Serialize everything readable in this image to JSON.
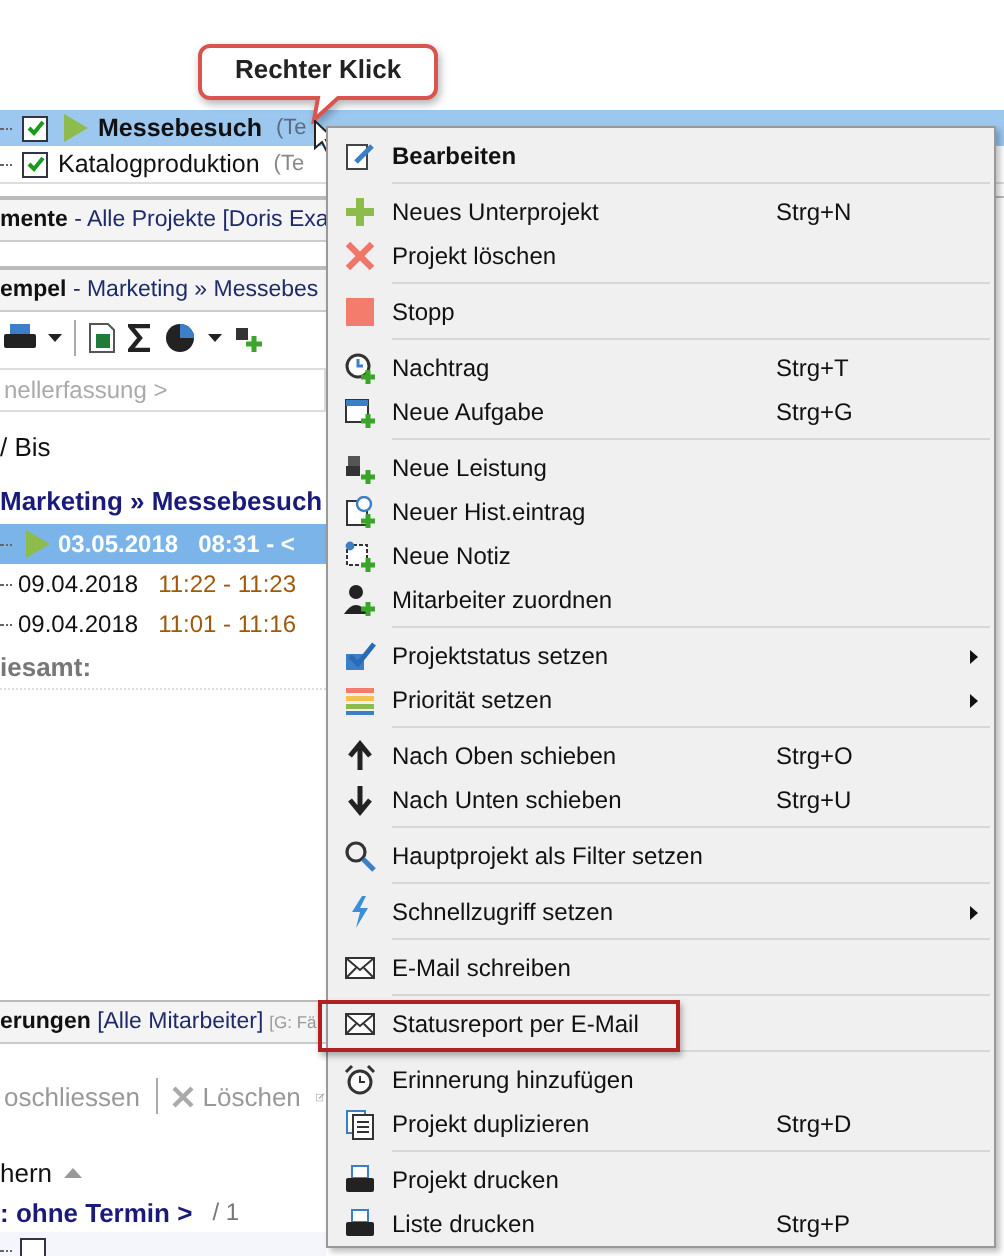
{
  "callout": {
    "text": "Rechter Klick"
  },
  "project_tree": {
    "rows": [
      {
        "name": "Messebesuch",
        "tag": "(Te",
        "checked": true,
        "running": true,
        "selected": true
      },
      {
        "name": "Katalogproduktion",
        "tag": "(Te",
        "checked": true,
        "running": false,
        "selected": false
      }
    ]
  },
  "documents_panel": {
    "title": "**mente** - Alle Projekte [Doris Exa"
  },
  "time_panel": {
    "title": "**empel** - Marketing » Messebes",
    "breadcrumb": "nellerfassung >",
    "column_header": "/ Bis",
    "group": "Marketing » Messebesuch",
    "rows": [
      {
        "date": "03.05.2018",
        "time": "08:31 - <",
        "selected": true,
        "running": true
      },
      {
        "date": "09.04.2018",
        "time": "11:22 - 11:23",
        "selected": false,
        "running": false
      },
      {
        "date": "09.04.2018",
        "time": "11:01 - 11:16",
        "selected": false,
        "running": false
      }
    ],
    "total_label": "iesamt:"
  },
  "reminders_panel": {
    "title": "**erungen** [Alle Mitarbeiter]",
    "filter": "[G: Fä",
    "toolbar": [
      "oschliessen",
      "Löschen"
    ],
    "sort_column": "hern",
    "group": ": ohne Termin >",
    "count": "/ 1",
    "rows": [
      {
        "checked": false
      }
    ]
  },
  "context_menu": {
    "groups": [
      [
        {
          "label": "Bearbeiten",
          "default": true,
          "submenu": false,
          "highlighted": false
        }
      ],
      [
        {
          "label": "Neues Unterprojekt",
          "shortcut": "Strg+N",
          "default": false,
          "submenu": false,
          "highlighted": false
        },
        {
          "label": "Projekt löschen",
          "default": false,
          "submenu": false,
          "highlighted": false
        }
      ],
      [
        {
          "label": "Stopp",
          "default": false,
          "submenu": false,
          "highlighted": false
        }
      ],
      [
        {
          "label": "Nachtrag",
          "shortcut": "Strg+T",
          "default": false,
          "submenu": false,
          "highlighted": false
        },
        {
          "label": "Neue Aufgabe",
          "shortcut": "Strg+G",
          "default": false,
          "submenu": false,
          "highlighted": false
        }
      ],
      [
        {
          "label": "Neue Leistung",
          "default": false,
          "submenu": false,
          "highlighted": false
        },
        {
          "label": "Neuer Hist.eintrag",
          "default": false,
          "submenu": false,
          "highlighted": false
        },
        {
          "label": "Neue Notiz",
          "default": false,
          "submenu": false,
          "highlighted": false
        },
        {
          "label": "Mitarbeiter zuordnen",
          "default": false,
          "submenu": false,
          "highlighted": false
        }
      ],
      [
        {
          "label": "Projektstatus setzen",
          "default": false,
          "submenu": true,
          "highlighted": false
        },
        {
          "label": "Priorität setzen",
          "default": false,
          "submenu": true,
          "highlighted": false
        }
      ],
      [
        {
          "label": "Nach Oben schieben",
          "shortcut": "Strg+O",
          "default": false,
          "submenu": false,
          "highlighted": false
        },
        {
          "label": "Nach Unten schieben",
          "shortcut": "Strg+U",
          "default": false,
          "submenu": false,
          "highlighted": false
        }
      ],
      [
        {
          "label": "Hauptprojekt als Filter setzen",
          "default": false,
          "submenu": false,
          "highlighted": false
        }
      ],
      [
        {
          "label": "Schnellzugriff setzen",
          "default": false,
          "submenu": true,
          "highlighted": false
        }
      ],
      [
        {
          "label": "E-Mail schreiben",
          "default": false,
          "submenu": false,
          "highlighted": false
        }
      ],
      [
        {
          "label": "Statusreport per E-Mail",
          "default": false,
          "submenu": false,
          "highlighted": true
        }
      ],
      [
        {
          "label": "Erinnerung hinzufügen",
          "default": false,
          "submenu": false,
          "highlighted": false
        },
        {
          "label": "Projekt duplizieren",
          "shortcut": "Strg+D",
          "default": false,
          "submenu": false,
          "highlighted": false
        }
      ],
      [
        {
          "label": "Projekt drucken",
          "default": false,
          "submenu": false,
          "highlighted": false
        },
        {
          "label": "Liste drucken",
          "shortcut": "Strg+P",
          "default": false,
          "submenu": false,
          "highlighted": false
        }
      ]
    ]
  }
}
